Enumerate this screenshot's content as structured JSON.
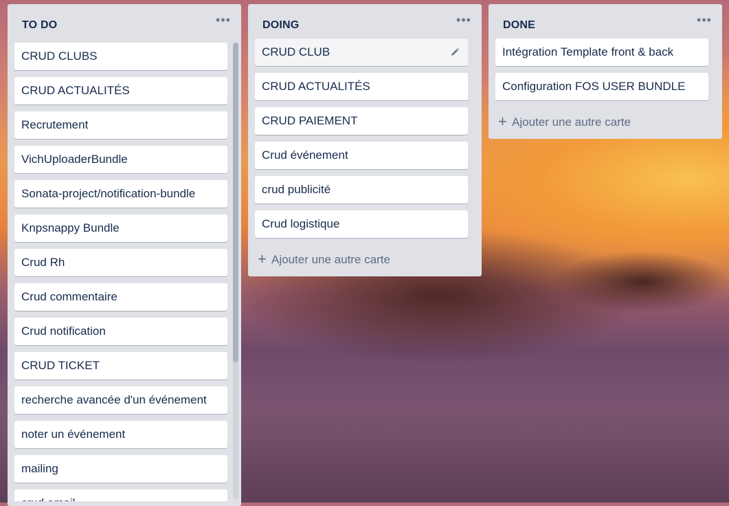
{
  "lists": {
    "todo": {
      "title": "TO DO",
      "menu": "•••",
      "cards": [
        "CRUD CLUBS",
        "CRUD ACTUALITÉS",
        "Recrutement",
        "VichUploaderBundle",
        "Sonata-project/notification-bundle",
        "Knpsnappy Bundle",
        "Crud Rh",
        "Crud commentaire",
        "Crud notification",
        "CRUD TICKET",
        "recherche avancée d'un événement",
        "noter un événement",
        "mailing",
        "crud email"
      ]
    },
    "doing": {
      "title": "DOING",
      "menu": "•••",
      "cards": [
        "CRUD CLUB",
        "CRUD ACTUALITÉS",
        "CRUD PAIEMENT",
        "Crud événement",
        "crud publicité",
        "Crud logistique"
      ],
      "add_card": "Ajouter une autre carte"
    },
    "done": {
      "title": "DONE",
      "menu": "•••",
      "cards": [
        "Intégration Template front & back",
        "Configuration FOS USER BUNDLE"
      ],
      "add_card": "Ajouter une autre carte"
    }
  },
  "icons": {
    "plus": "+",
    "edit": "pencil-icon"
  },
  "colors": {
    "list_bg": "#dfe1e6",
    "card_bg": "#ffffff",
    "title_text": "#172b4d",
    "muted_text": "#5e6c84"
  }
}
